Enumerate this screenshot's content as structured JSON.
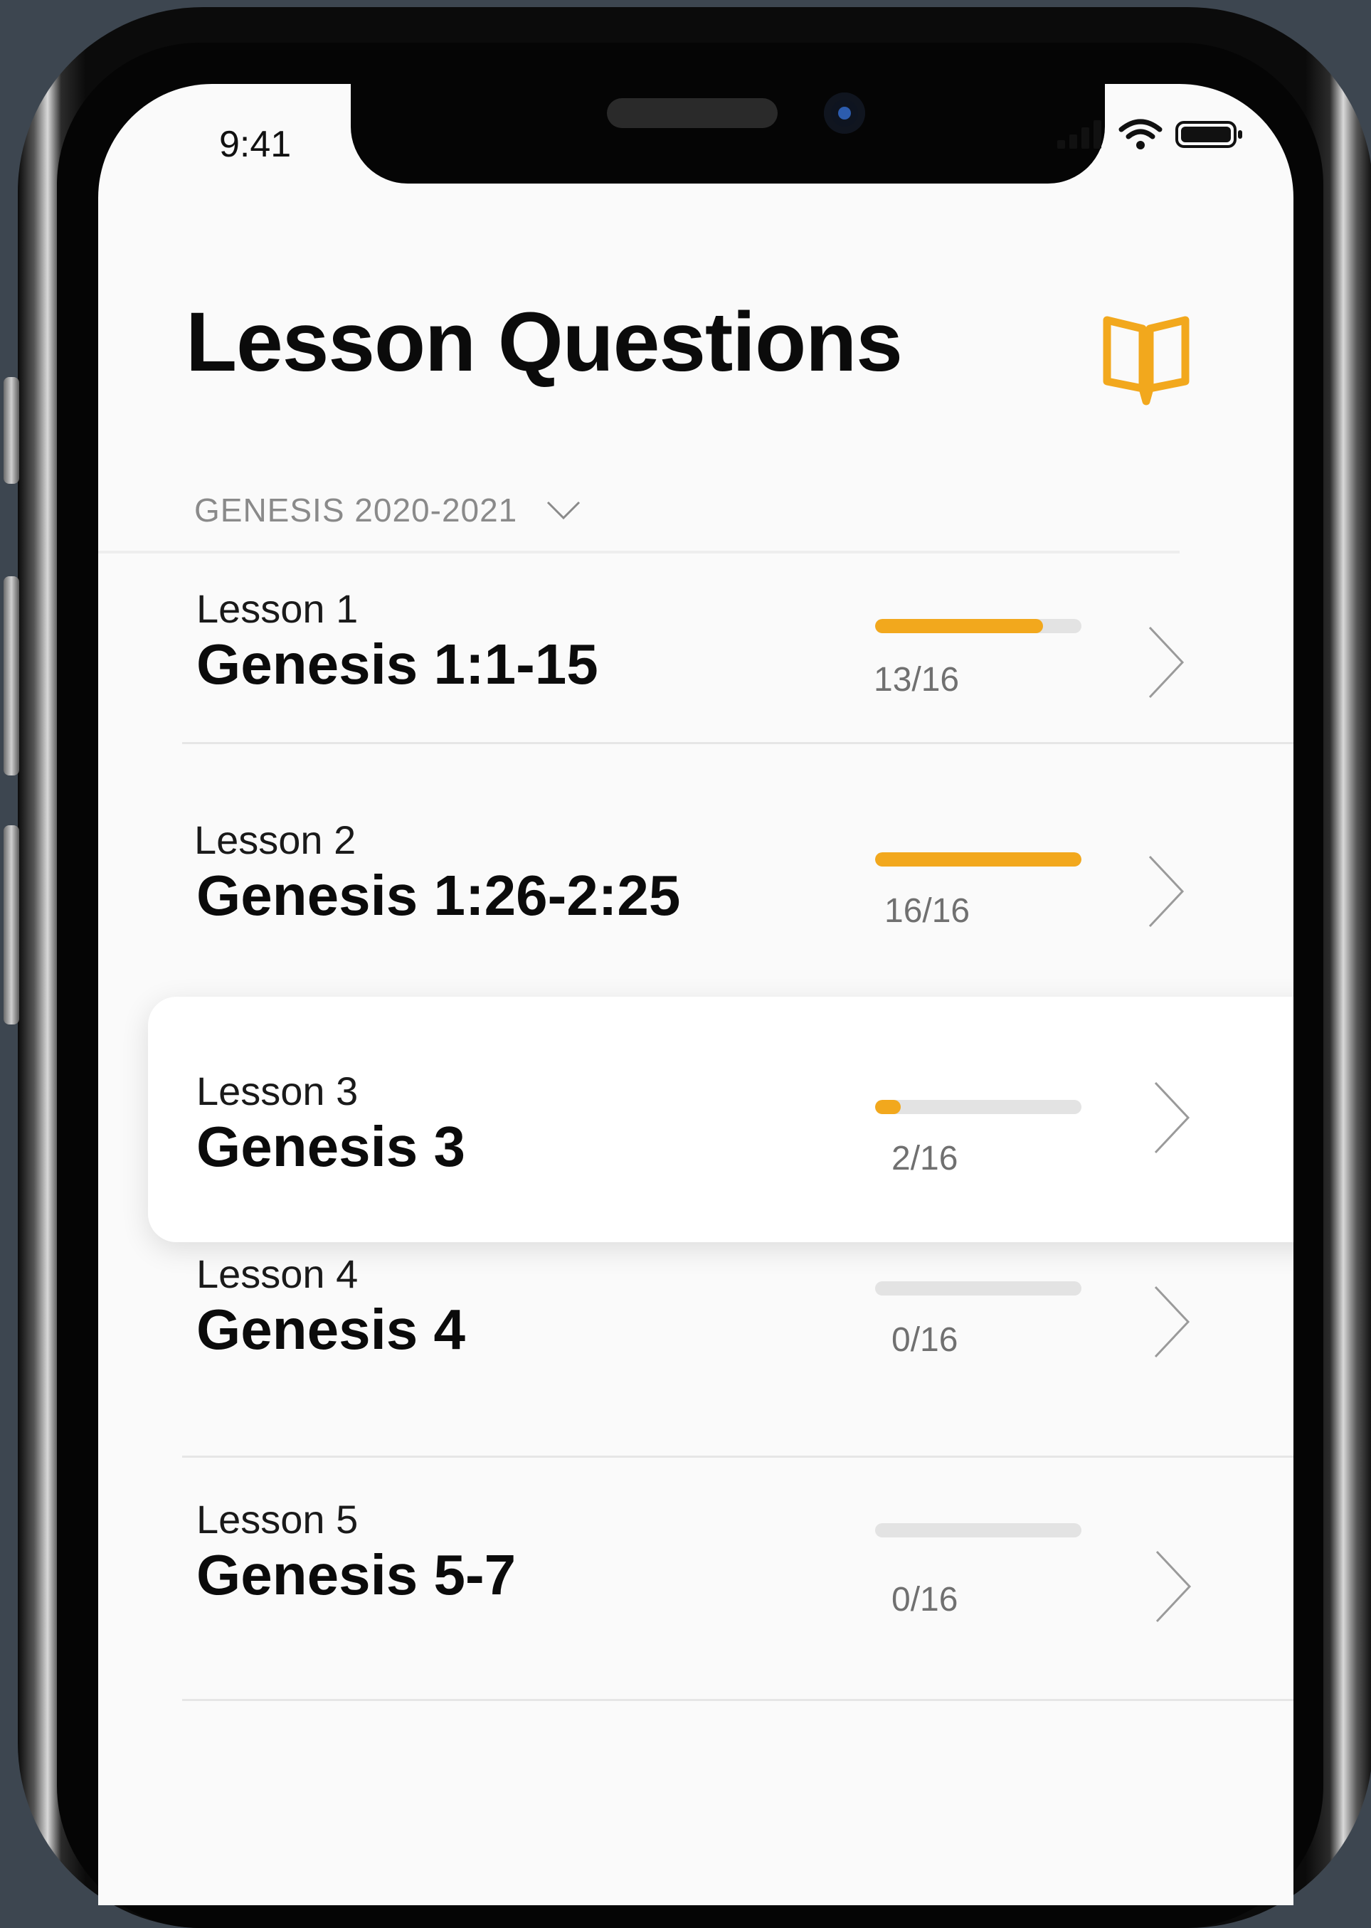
{
  "status_bar": {
    "time": "9:41"
  },
  "header": {
    "title": "Lesson Questions",
    "icon": "open-book-icon"
  },
  "selector": {
    "label": "GENESIS 2020-2021",
    "icon": "chevron-down-icon"
  },
  "accent_color": "#f2a81d",
  "lessons": [
    {
      "number": "Lesson 1",
      "title": "Genesis 1:1-15",
      "progress_text": "13/16",
      "progress": 0.8125
    },
    {
      "number": "Lesson 2",
      "title": "Genesis 1:26-2:25",
      "progress_text": "16/16",
      "progress": 1.0
    },
    {
      "number": "Lesson 3",
      "title": "Genesis 3",
      "progress_text": "2/16",
      "progress": 0.125
    },
    {
      "number": "Lesson 4",
      "title": "Genesis 4",
      "progress_text": "0/16",
      "progress": 0
    },
    {
      "number": "Lesson 5",
      "title": "Genesis 5-7",
      "progress_text": "0/16",
      "progress": 0
    }
  ]
}
